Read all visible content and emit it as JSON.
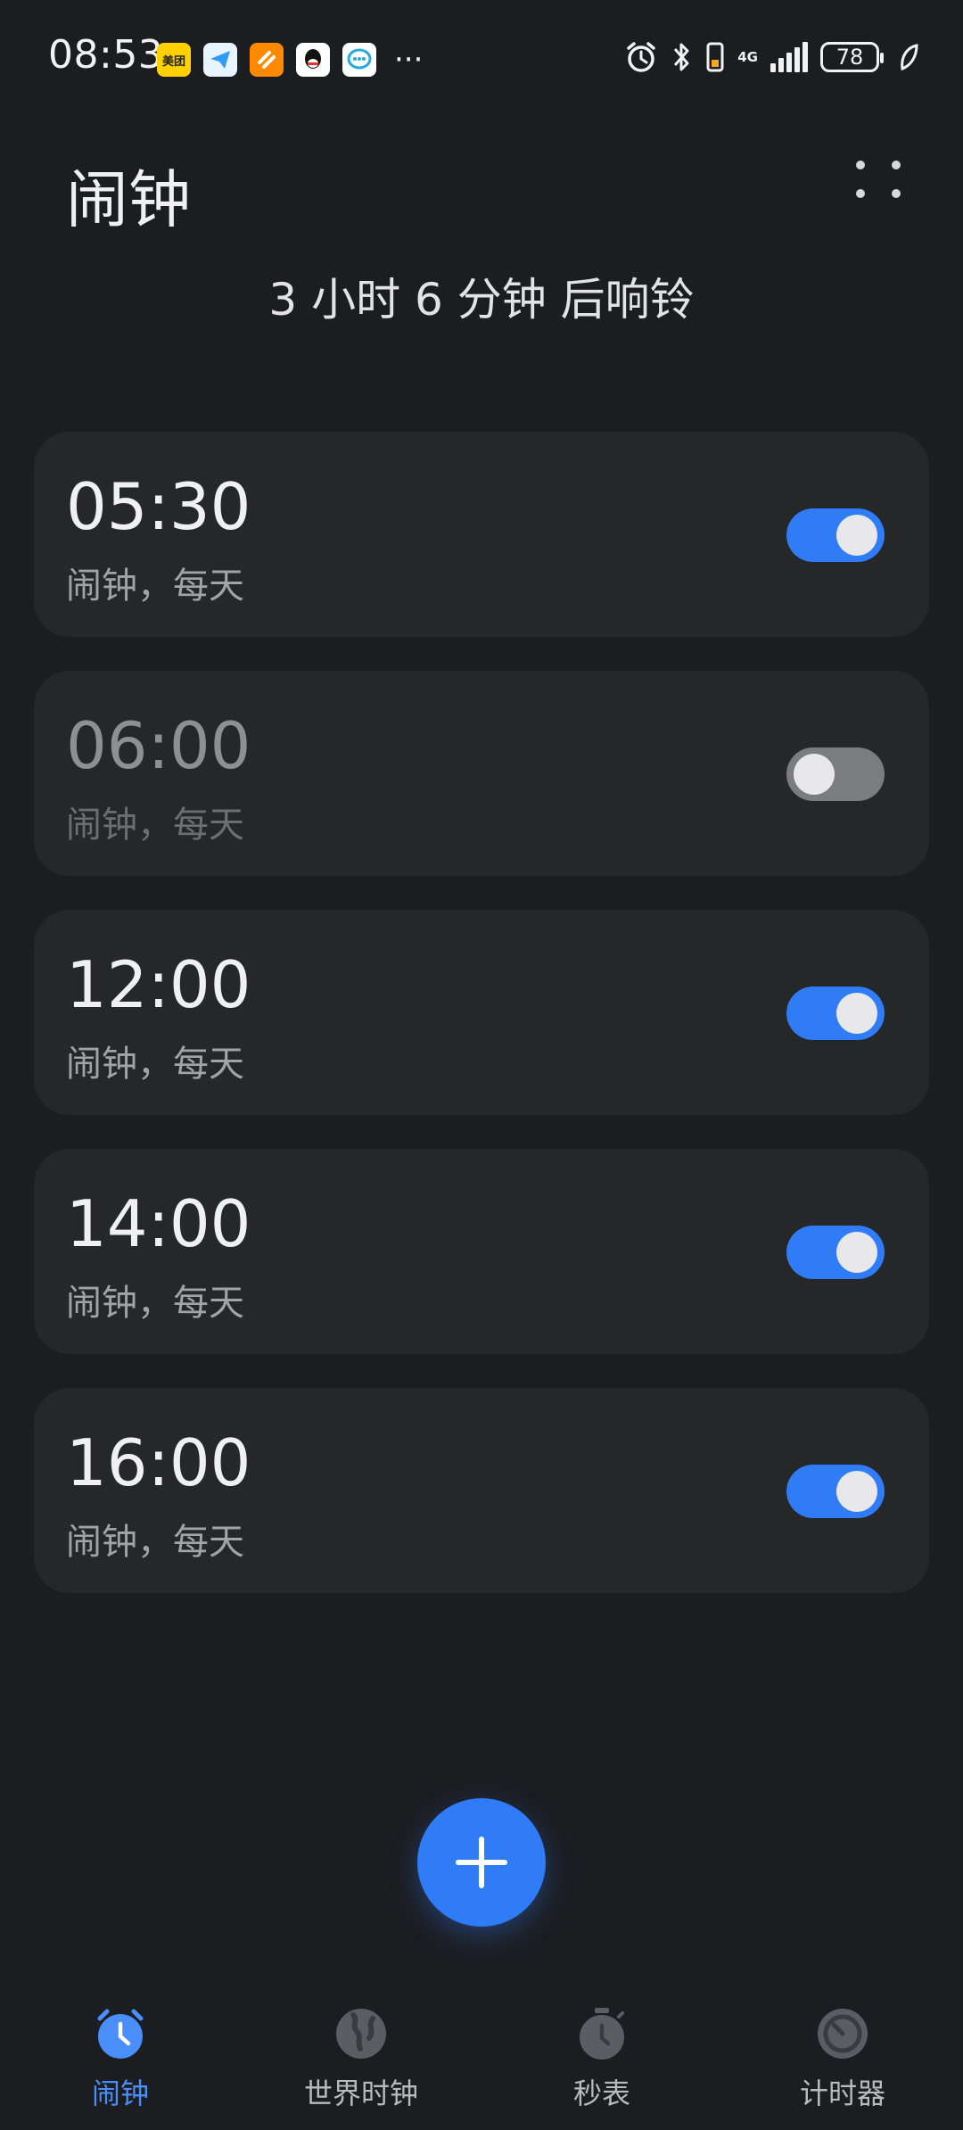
{
  "status_bar": {
    "time": "08:53",
    "app_icons": [
      "meituan-icon",
      "feishu-icon",
      "orange-app-icon",
      "qq-icon",
      "chat-icon"
    ],
    "meituan_text": "美团",
    "more": "···",
    "network_label": "4G",
    "battery": "78"
  },
  "header": {
    "title": "闹钟",
    "subtitle": "3 小时 6 分钟 后响铃"
  },
  "alarms": [
    {
      "time": "05:30",
      "label": "闹钟，每天",
      "enabled": true
    },
    {
      "time": "06:00",
      "label": "闹钟，每天",
      "enabled": false
    },
    {
      "time": "12:00",
      "label": "闹钟，每天",
      "enabled": true
    },
    {
      "time": "14:00",
      "label": "闹钟，每天",
      "enabled": true
    },
    {
      "time": "16:00",
      "label": "闹钟，每天",
      "enabled": true
    }
  ],
  "nav": {
    "items": [
      {
        "label": "闹钟",
        "icon": "alarm-clock-icon",
        "active": true
      },
      {
        "label": "世界时钟",
        "icon": "globe-icon",
        "active": false
      },
      {
        "label": "秒表",
        "icon": "stopwatch-icon",
        "active": false
      },
      {
        "label": "计时器",
        "icon": "timer-icon",
        "active": false
      }
    ]
  },
  "colors": {
    "background": "#1c1d21",
    "card": "#262729",
    "accent": "#2f7cf6",
    "toggle_off": "#7b7c80"
  }
}
